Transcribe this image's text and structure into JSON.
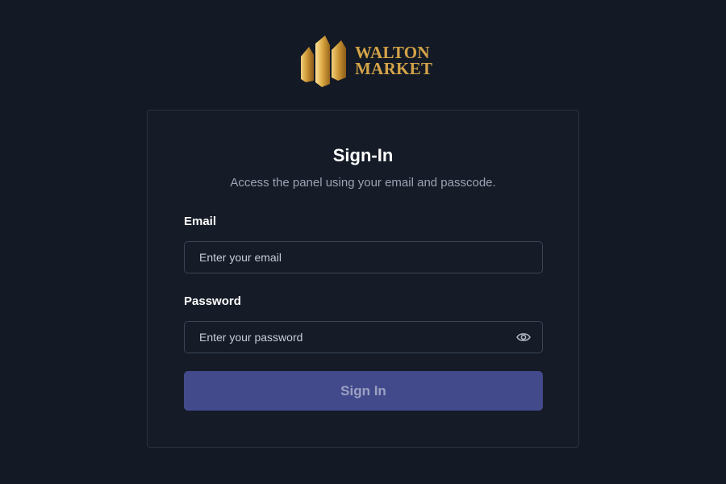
{
  "brand": {
    "line1": "WALTON",
    "line2": "MARKET",
    "gold": "#d4a349",
    "logo_icon": "gold-bars-icon"
  },
  "signin": {
    "title": "Sign-In",
    "subtitle": "Access the panel using your email and passcode.",
    "email": {
      "label": "Email",
      "placeholder": "Enter your email",
      "value": ""
    },
    "password": {
      "label": "Password",
      "placeholder": "Enter your password",
      "value": "",
      "toggle_icon": "eye-icon"
    },
    "submit_label": "Sign In"
  },
  "colors": {
    "background": "#131a25",
    "card": "#151b27",
    "card_border": "#293242",
    "input_border": "#3a4556",
    "button": "#424a8c",
    "button_text": "#9ca1c2"
  }
}
